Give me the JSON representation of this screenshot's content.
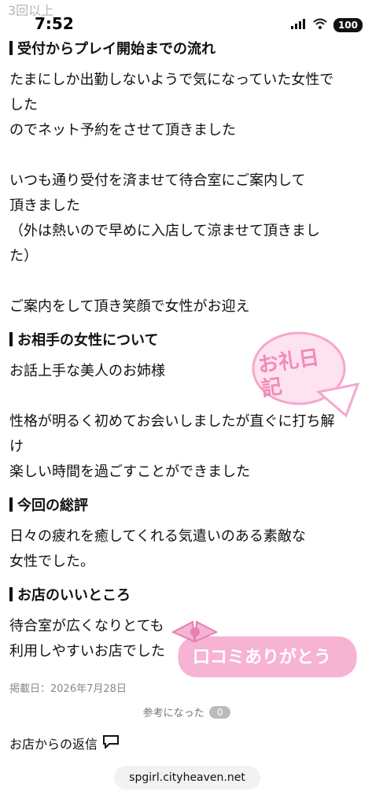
{
  "ghost_header": "3回以上",
  "status_bar": {
    "time": "7:52",
    "battery": "100",
    "icons": [
      "signal-icon",
      "wifi-icon"
    ]
  },
  "sections": [
    {
      "title": "受付からプレイ開始までの流れ",
      "paragraphs": [
        [
          "たまにしか出勤しないようで気になっていた女性で",
          "した",
          "のでネット予約をさせて頂きました"
        ],
        [
          "いつも通り受付を済ませて待合室にご案内して",
          "頂きました",
          "（外は熱いので早めに入店して涼ませて頂きまし",
          "た）"
        ],
        [
          "ご案内をして頂き笑顔で女性がお迎え"
        ]
      ]
    },
    {
      "title": "お相手の女性について",
      "paragraphs": [
        [
          "お話上手な美人のお姉様"
        ],
        [
          "性格が明るく初めてお会いしましたが直ぐに打ち解",
          "け",
          "楽しい時間を過ごすことができました"
        ]
      ]
    },
    {
      "title": "今回の総評",
      "paragraphs": [
        [
          "日々の疲れを癒してくれる気遣いのある素敵な",
          "女性でした。"
        ]
      ]
    },
    {
      "title": "お店のいいところ",
      "paragraphs": [
        [
          "待合室が広くなりとても",
          "利用しやすいお店でした"
        ]
      ]
    }
  ],
  "posted": "掲載日：2026年7月28日",
  "helpful": {
    "label": "参考になった",
    "count": "0"
  },
  "shop_reply": "お店からの返信",
  "url_bar": "spgirl.cityheaven.net",
  "stamps": [
    {
      "text": "お礼日記",
      "color": "#f4a8cc"
    },
    {
      "text": "口コミありがとう",
      "color": "#f4a8cc"
    }
  ],
  "colors": {
    "pink": "#f4a8cc",
    "pink_dark": "#e77fb2"
  }
}
